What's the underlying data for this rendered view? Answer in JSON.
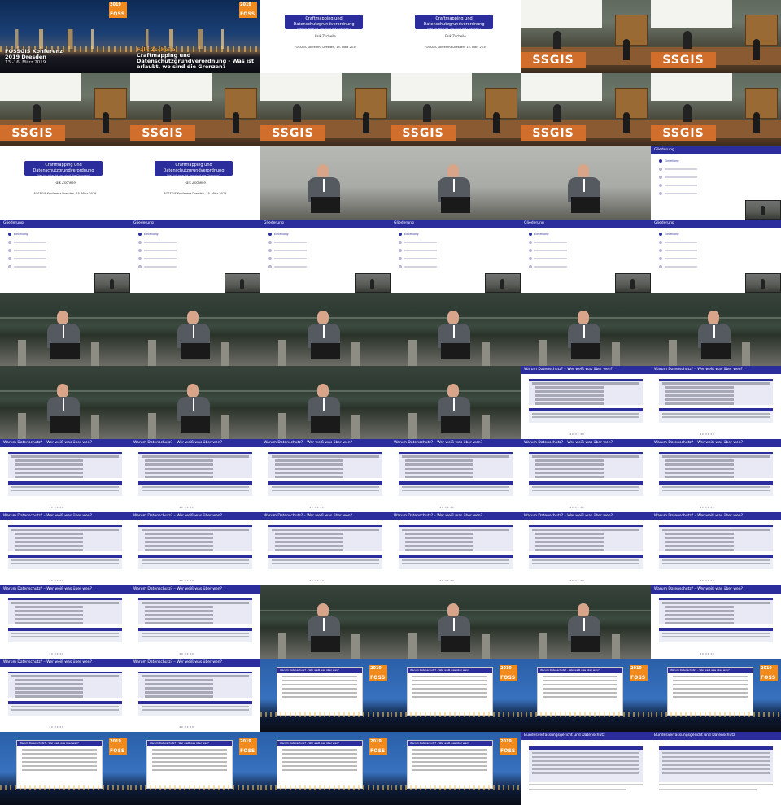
{
  "conference": {
    "logo_year": "2019",
    "logo_text": "FOSS",
    "title_line": "FOSSGIS Konferenz",
    "title_line2": "2019 Dresden",
    "title_line3": "13.-16. März 2019",
    "author": "Falk Zscheile",
    "talk_title": "Craftmapping und Datenschutzgrundverordnung - Was ist erlaubt, wo sind die Grenzen?"
  },
  "title_slide": {
    "heading": "Craftmapping und Datenschutzgrundverordnung",
    "subheading": "Was ist erlaubt, wo sind die Grenzen?",
    "author": "Falk Zscheile",
    "event": "FOSSGIS Konferenz Dresden, 15. März 2019"
  },
  "hall": {
    "banner": "SSGIS"
  },
  "outline": {
    "title": "Gliederung",
    "items": [
      "Einleitung"
    ]
  },
  "content_slide": {
    "title": "Warum Datenschutz? – Wer weiß was über wen?"
  },
  "law_slide": {
    "title": "Bundesverfassungsgericht und Datenschutz"
  },
  "colors": {
    "beamer_blue": "#2b2d9c",
    "orange": "#f08a1d"
  },
  "tiles": [
    "title",
    "title2",
    "slide",
    "slide",
    "hall",
    "hall",
    "hall",
    "hall",
    "hall",
    "hall",
    "hall",
    "hall",
    "slide",
    "slide",
    "speaker-grey",
    "speaker-grey",
    "speaker-grey",
    "outline",
    "outline",
    "outline",
    "outline",
    "outline",
    "outline",
    "outline",
    "speaker-green",
    "speaker-green",
    "speaker-green",
    "speaker-green",
    "speaker-green",
    "speaker-green",
    "speaker-green",
    "speaker-green",
    "speaker-green",
    "speaker-green",
    "content",
    "content",
    "content",
    "content",
    "content",
    "content",
    "content",
    "content",
    "content",
    "content",
    "content",
    "content",
    "content",
    "content",
    "content",
    "content",
    "speaker-green",
    "speaker-green",
    "speaker-green",
    "content",
    "content",
    "content",
    "wallslide",
    "wallslide",
    "wallslide",
    "wallslide",
    "wallslide",
    "wallslide",
    "wallslide",
    "wallslide",
    "law",
    "law"
  ]
}
